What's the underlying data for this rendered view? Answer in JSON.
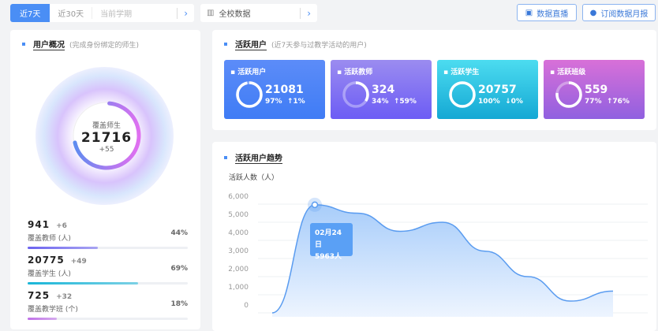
{
  "toolbar": {
    "range_tabs": [
      "近7天",
      "近30天"
    ],
    "term_placeholder": "当前学期",
    "scope": "全校数据",
    "live_btn": "数据直播",
    "subscribe_btn": "订阅数据月报"
  },
  "overview": {
    "title": "用户概况",
    "subtitle": "(完成身份绑定的师生)",
    "ring_label": "覆盖师生",
    "ring_value": "21716",
    "ring_delta": "+55",
    "ring_progress": 0.7,
    "rows": [
      {
        "value": "941",
        "delta": "+6",
        "label": "覆盖教师 (人)",
        "percent": "44%",
        "fraction": 0.44,
        "color": "#6c63f0"
      },
      {
        "value": "20775",
        "delta": "+49",
        "label": "覆盖学生 (人)",
        "percent": "69%",
        "fraction": 0.69,
        "color": "#19b6d8"
      },
      {
        "value": "725",
        "delta": "+32",
        "label": "覆盖教学班 (个)",
        "percent": "18%",
        "fraction": 0.18,
        "color": "#c070e8"
      }
    ]
  },
  "active": {
    "title": "活跃用户",
    "subtitle": "(近7天参与过教学活动的用户)",
    "cards": [
      {
        "label": "活跃用户",
        "value": "21081",
        "pct": "97%",
        "change": "↑1%",
        "fraction": 0.97
      },
      {
        "label": "活跃教师",
        "value": "324",
        "pct": "34%",
        "change": "↑59%",
        "fraction": 0.34
      },
      {
        "label": "活跃学生",
        "value": "20757",
        "pct": "100%",
        "change": "↓0%",
        "fraction": 1.0
      },
      {
        "label": "活跃班级",
        "value": "559",
        "pct": "77%",
        "change": "↑76%",
        "fraction": 0.77
      }
    ]
  },
  "trend": {
    "title": "活跃用户趋势",
    "tooltip_date": "02月24日",
    "tooltip_value": "5963人"
  },
  "chart_data": {
    "type": "area",
    "title": "活跃用户趋势",
    "ylabel": "活跃人数（人）",
    "ylim": [
      0,
      6000
    ],
    "yticks": [
      "6,000",
      "5,000",
      "4,000",
      "3,000",
      "2,000",
      "1,000",
      "0"
    ],
    "x": [
      0,
      1,
      2,
      3,
      4,
      5,
      6,
      7,
      8
    ],
    "values": [
      0,
      5963,
      5500,
      4500,
      5000,
      3400,
      2000,
      650,
      1200
    ],
    "highlight_index": 1,
    "grid": true
  }
}
